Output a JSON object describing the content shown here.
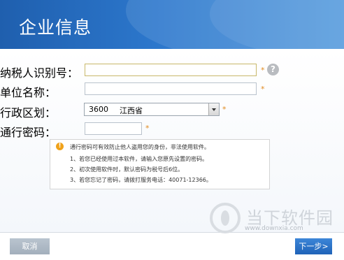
{
  "header": {
    "title": "企业信息"
  },
  "form": {
    "tax_id_label": "纳税人识别号：",
    "company_label": "单位名称：",
    "region_label": "行政区划：",
    "password_label": "通行密码：",
    "required_mark": "*",
    "help_symbol": "?",
    "region_code": "3600",
    "region_name": "江西省",
    "tax_id_value": "",
    "company_value": "",
    "password_value": ""
  },
  "notice": {
    "warn_symbol": "!",
    "line1": "通行密码可有效防止他人盗用您的身份，非法使用软件。",
    "line2": "1、若您已经使用过本软件，请输入您原先设置的密码。",
    "line3": "2、初次使用软件时，默认密码为税号后6位。",
    "line4": "3、若您忘记了密码，请拨打服务电话：40071-12366。"
  },
  "footer": {
    "cancel_label": "取消",
    "next_label": "下一步>"
  },
  "watermark": {
    "text": "当下软件园",
    "url": "www.downxia.com"
  },
  "colors": {
    "header_blue": "#2c77cc",
    "required_orange": "#e08a1e",
    "next_blue": "#1f63b8"
  },
  "icons": {
    "help": "question-circle-icon",
    "warning": "warning-circle-icon",
    "dropdown": "chevron-down-icon"
  }
}
